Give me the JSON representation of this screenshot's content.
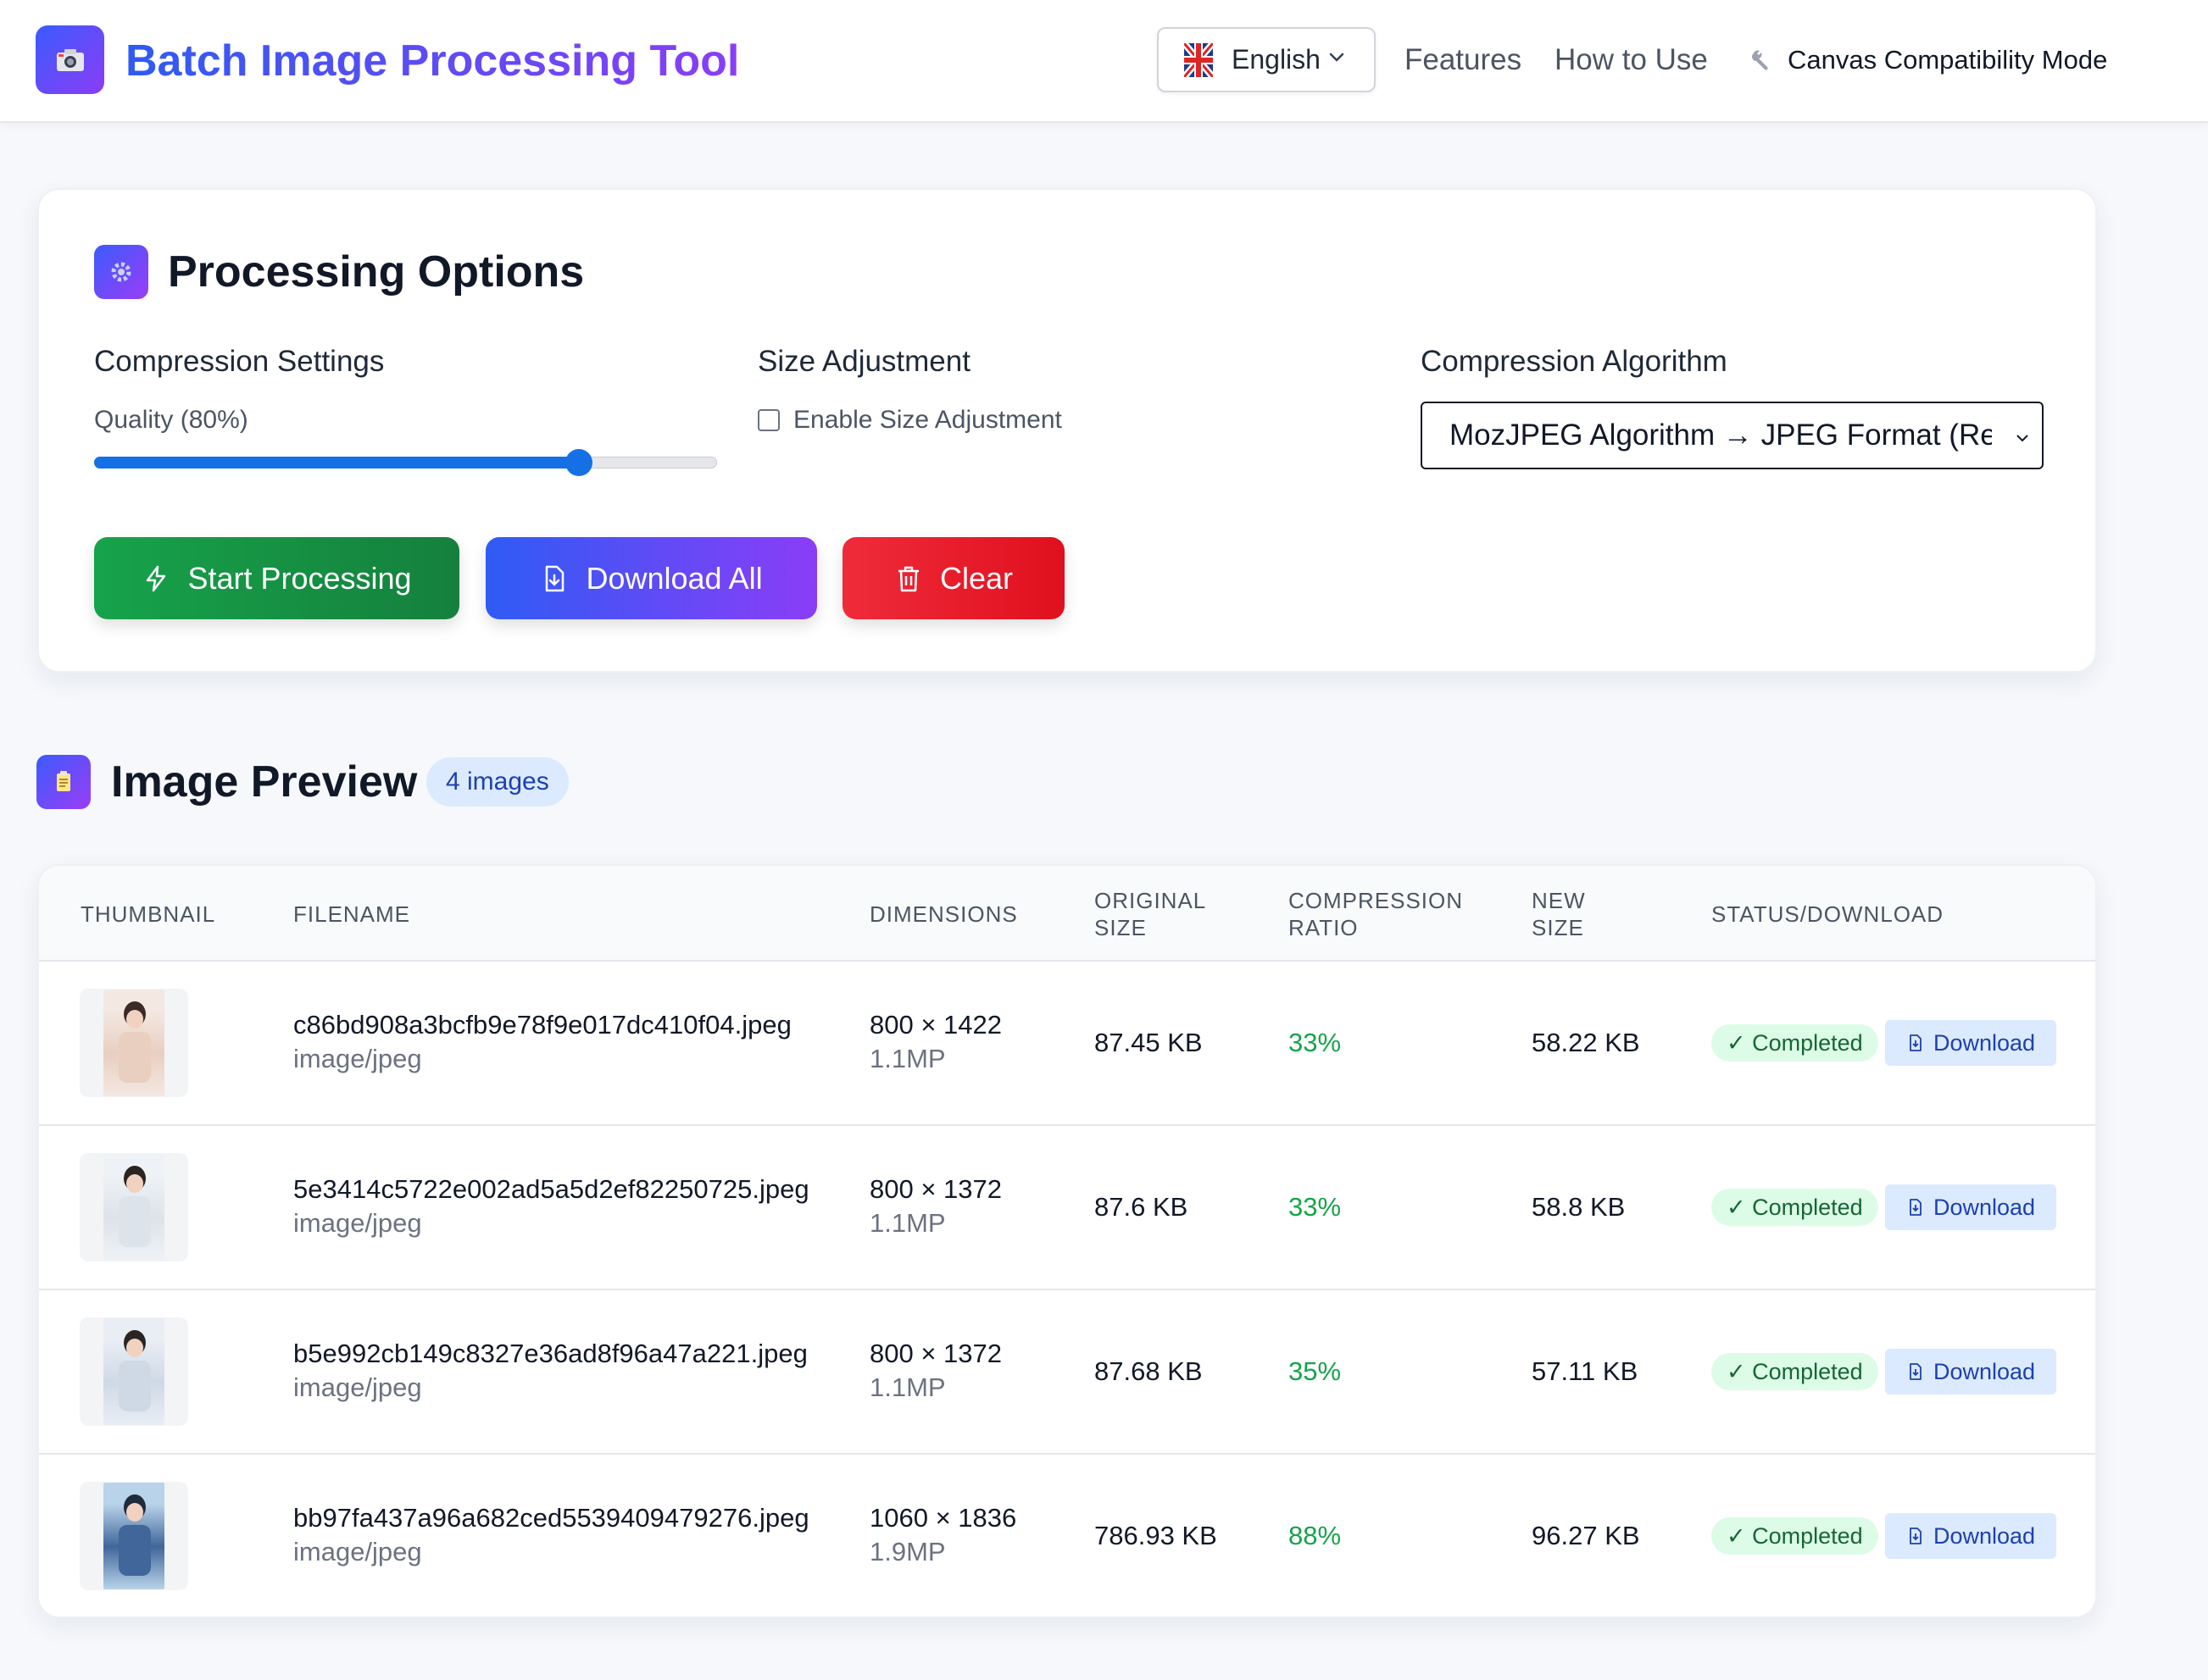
{
  "header": {
    "title": "Batch Image Processing Tool",
    "logo_icon": "camera-icon",
    "language": "English",
    "nav": {
      "features": "Features",
      "how_to_use": "How to Use",
      "compat_mode": "Canvas Compatibility Mode"
    }
  },
  "options": {
    "title": "Processing Options",
    "compression_label": "Compression Settings",
    "quality_label": "Quality (80%)",
    "quality_value": 80,
    "size_label": "Size Adjustment",
    "enable_size_label": "Enable Size Adjustment",
    "enable_size_checked": false,
    "algorithm_label": "Compression Algorithm",
    "algorithm_value": "MozJPEG Algorithm → JPEG Format (Reco",
    "buttons": {
      "start": "Start Processing",
      "download_all": "Download All",
      "clear": "Clear"
    }
  },
  "preview": {
    "title": "Image Preview",
    "count_badge": "4 images",
    "columns": {
      "thumbnail": "THUMBNAIL",
      "filename": "FILENAME",
      "dimensions": "DIMENSIONS",
      "original_1": "ORIGINAL",
      "original_2": "SIZE",
      "ratio_1": "COMPRESSION",
      "ratio_2": "RATIO",
      "new_1": "NEW",
      "new_2": "SIZE",
      "status": "STATUS/DOWNLOAD"
    },
    "rows": [
      {
        "filename": "c86bd908a3bcfb9e78f9e017dc410f04.jpeg",
        "type": "image/jpeg",
        "dims": "800 × 1422",
        "mp": "1.1MP",
        "original": "87.45 KB",
        "ratio": "33%",
        "new_size": "58.22 KB",
        "status": "✓ Completed",
        "download": "Download"
      },
      {
        "filename": "5e3414c5722e002ad5a5d2ef82250725.jpeg",
        "type": "image/jpeg",
        "dims": "800 × 1372",
        "mp": "1.1MP",
        "original": "87.6 KB",
        "ratio": "33%",
        "new_size": "58.8 KB",
        "status": "✓ Completed",
        "download": "Download"
      },
      {
        "filename": "b5e992cb149c8327e36ad8f96a47a221.jpeg",
        "type": "image/jpeg",
        "dims": "800 × 1372",
        "mp": "1.1MP",
        "original": "87.68 KB",
        "ratio": "35%",
        "new_size": "57.11 KB",
        "status": "✓ Completed",
        "download": "Download"
      },
      {
        "filename": "bb97fa437a96a682ced5539409479276.jpeg",
        "type": "image/jpeg",
        "dims": "1060 × 1836",
        "mp": "1.9MP",
        "original": "786.93 KB",
        "ratio": "88%",
        "new_size": "96.27 KB",
        "status": "✓ Completed",
        "download": "Download"
      }
    ]
  },
  "colors": {
    "accent_blue": "#2f5bf3",
    "accent_purple": "#8b3df6",
    "success_green": "#16a34a",
    "danger_red": "#e0101e"
  }
}
